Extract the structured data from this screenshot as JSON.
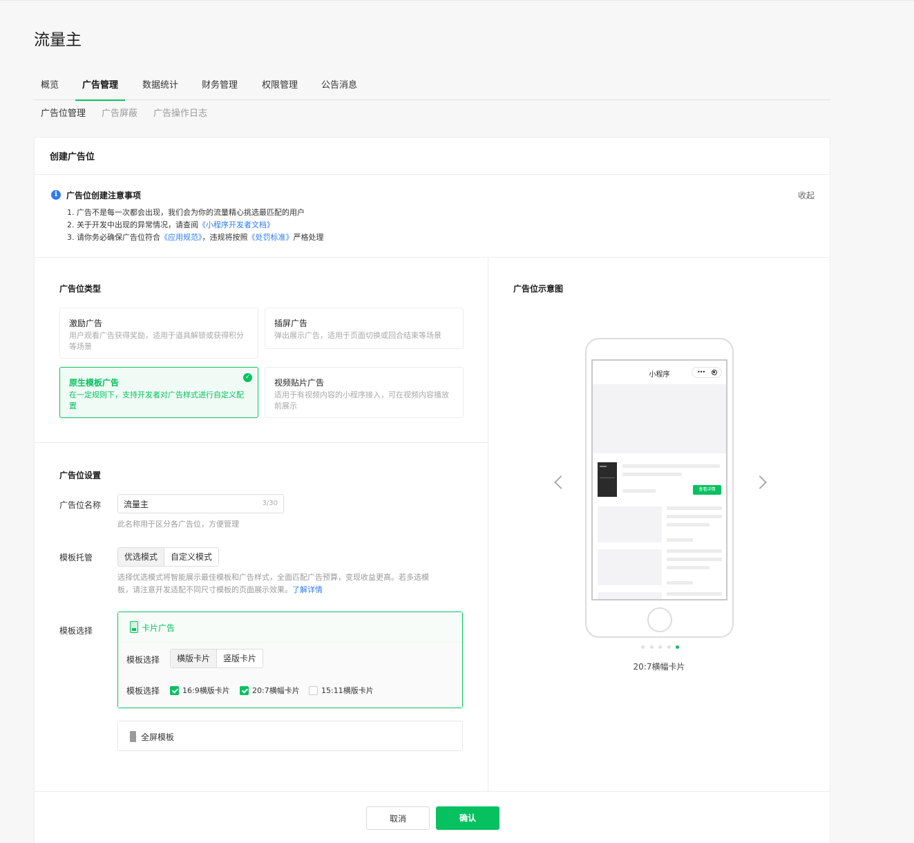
{
  "page_title": "流量主",
  "tabs": [
    {
      "label": "概览"
    },
    {
      "label": "广告管理"
    },
    {
      "label": "数据统计"
    },
    {
      "label": "财务管理"
    },
    {
      "label": "权限管理"
    },
    {
      "label": "公告消息"
    }
  ],
  "subtabs": [
    {
      "label": "广告位管理"
    },
    {
      "label": "广告屏蔽"
    },
    {
      "label": "广告操作日志"
    }
  ],
  "card_title": "创建广告位",
  "notice": {
    "title": "广告位创建注意事项",
    "collapse": "收起",
    "line1": "1. 广告不是每一次都会出现，我们会为你的流量精心挑选最匹配的用户",
    "line2_pre": "2. 关于开发中出现的异常情况，请查阅",
    "line2_link": "《小程序开发者文档》",
    "line3_pre": "3. 请你务必确保广告位符合",
    "line3_link1": "《应用规范》",
    "line3_mid": "，违规将按照",
    "line3_link2": "《处罚标准》",
    "line3_post": "严格处理"
  },
  "ad_type": {
    "section_title": "广告位类型",
    "options": [
      {
        "title": "激励广告",
        "desc": "用户观看广告获得奖励，适用于道具解锁或获得积分等场景"
      },
      {
        "title": "插屏广告",
        "desc": "弹出展示广告，适用于页面切换或回合结束等场景"
      },
      {
        "title": "原生模板广告",
        "desc": "在一定规则下，支持开发者对广告样式进行自定义配置"
      },
      {
        "title": "视频贴片广告",
        "desc": "适用于有视频内容的小程序接入，可在视频内容播放前展示"
      }
    ]
  },
  "settings": {
    "section_title": "广告位设置",
    "name_label": "广告位名称",
    "name_value": "流量主",
    "name_count": "3/30",
    "name_hint": "此名称用于区分各广告位，方便管理",
    "hosting_label": "模板托管",
    "hosting_options": [
      "优选模式",
      "自定义模式"
    ],
    "hosting_hint1": "选择优选模式将智能展示最佳模板和广告样式，全面匹配广告预算，变现收益更高。若多选模",
    "hosting_hint2": "板，请注意开发适配不同尺寸模板的页面展示效果。",
    "hosting_hint_link": "了解详情",
    "template_label": "模板选择",
    "card_template": {
      "name": "卡片广告",
      "row1_label": "模板选择",
      "row1_options": [
        "横版卡片",
        "竖版卡片"
      ],
      "row2_label": "模板选择",
      "checkboxes": [
        {
          "label": "16:9横版卡片",
          "checked": true
        },
        {
          "label": "20:7横幅卡片",
          "checked": true
        },
        {
          "label": "15:11横版卡片",
          "checked": false
        }
      ]
    },
    "full_template": {
      "name": "全屏模板"
    }
  },
  "preview": {
    "section_title": "广告位示意图",
    "nav_title": "小程序",
    "capsule_dots": "•••",
    "ad_button": "查看详情",
    "caption": "20:7横幅卡片",
    "page_count": 5,
    "active_page": 5
  },
  "footer": {
    "cancel": "取消",
    "confirm": "确认"
  },
  "colors": {
    "accent": "#07c160",
    "link": "#2e7cf6"
  }
}
